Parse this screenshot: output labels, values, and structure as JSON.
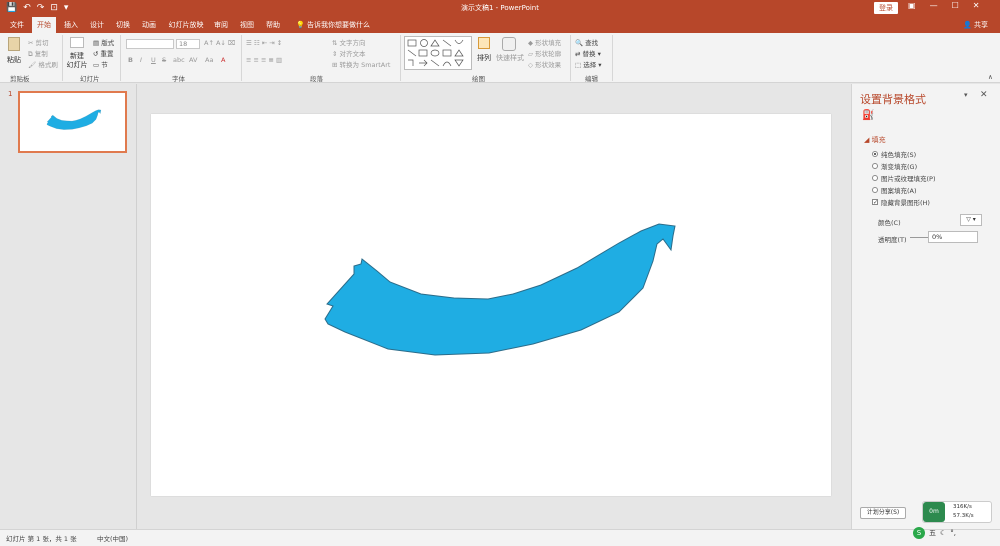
{
  "titlebar": {
    "doc_title": "演示文稿1 - PowerPoint",
    "login": "登录",
    "qat": [
      "💾",
      "↶",
      "↷",
      "⊡",
      "▾"
    ],
    "win": [
      "▣",
      "—",
      "☐",
      "✕"
    ]
  },
  "tabs": [
    {
      "label": "文件",
      "active": false
    },
    {
      "label": "开始",
      "active": true
    },
    {
      "label": "插入",
      "active": false
    },
    {
      "label": "设计",
      "active": false
    },
    {
      "label": "切换",
      "active": false
    },
    {
      "label": "动画",
      "active": false
    },
    {
      "label": "幻灯片放映",
      "active": false
    },
    {
      "label": "审阅",
      "active": false
    },
    {
      "label": "视图",
      "active": false
    },
    {
      "label": "帮助",
      "active": false
    }
  ],
  "tellme": "告诉我你想要做什么",
  "share": "共享",
  "ribbon": {
    "clipboard": {
      "paste": "粘贴",
      "cut": "剪切",
      "copy": "复制",
      "format_painter": "格式刷",
      "label": "剪贴板"
    },
    "slides": {
      "new_slide": "新建",
      "new_slide2": "幻灯片",
      "layout": "版式",
      "reset": "重置",
      "section": "节",
      "label": "幻灯片"
    },
    "font": {
      "size_value": "18",
      "bold": "B",
      "italic": "I",
      "underline": "U",
      "strike": "S",
      "shadow": "abc",
      "spacing": "AV",
      "case": "Aa",
      "color": "A",
      "label": "字体"
    },
    "paragraph": {
      "text_direction": "文字方向",
      "align_text": "对齐文本",
      "smartart": "转换为 SmartArt",
      "label": "段落"
    },
    "drawing": {
      "arrange": "排列",
      "quick_styles": "快速样式",
      "shape_fill": "形状填充",
      "shape_outline": "形状轮廓",
      "shape_effects": "形状效果",
      "label": "绘图"
    },
    "editing": {
      "find": "查找",
      "replace": "替换",
      "select": "选择",
      "label": "编辑"
    }
  },
  "thumbnails": {
    "slide_number": "1"
  },
  "format_pane": {
    "title": "设置背景格式",
    "fill_header": "填充",
    "options": [
      {
        "label": "纯色填充(S)",
        "type": "radio",
        "checked": true
      },
      {
        "label": "渐变填充(G)",
        "type": "radio",
        "checked": false
      },
      {
        "label": "图片或纹理填充(P)",
        "type": "radio",
        "checked": false
      },
      {
        "label": "图案填充(A)",
        "type": "radio",
        "checked": false
      },
      {
        "label": "隐藏背景图形(H)",
        "type": "checkbox",
        "checked": true
      }
    ],
    "color_label": "颜色(C)",
    "transparency_label": "透明度(T)",
    "transparency_value": "0%"
  },
  "shape": {
    "fill": "#1fade3",
    "stroke": "#2b6c8a"
  },
  "statusbar": {
    "slide_info": "幻灯片 第 1 张，共 1 张",
    "language": "中文(中国)"
  },
  "overlay": {
    "ime_text": "计划分享(S)",
    "net_badge": "0m",
    "net_up": "316K/s",
    "net_down": "57.3K/s",
    "tray_text": "五"
  },
  "colors": {
    "brand": "#b7472a"
  }
}
